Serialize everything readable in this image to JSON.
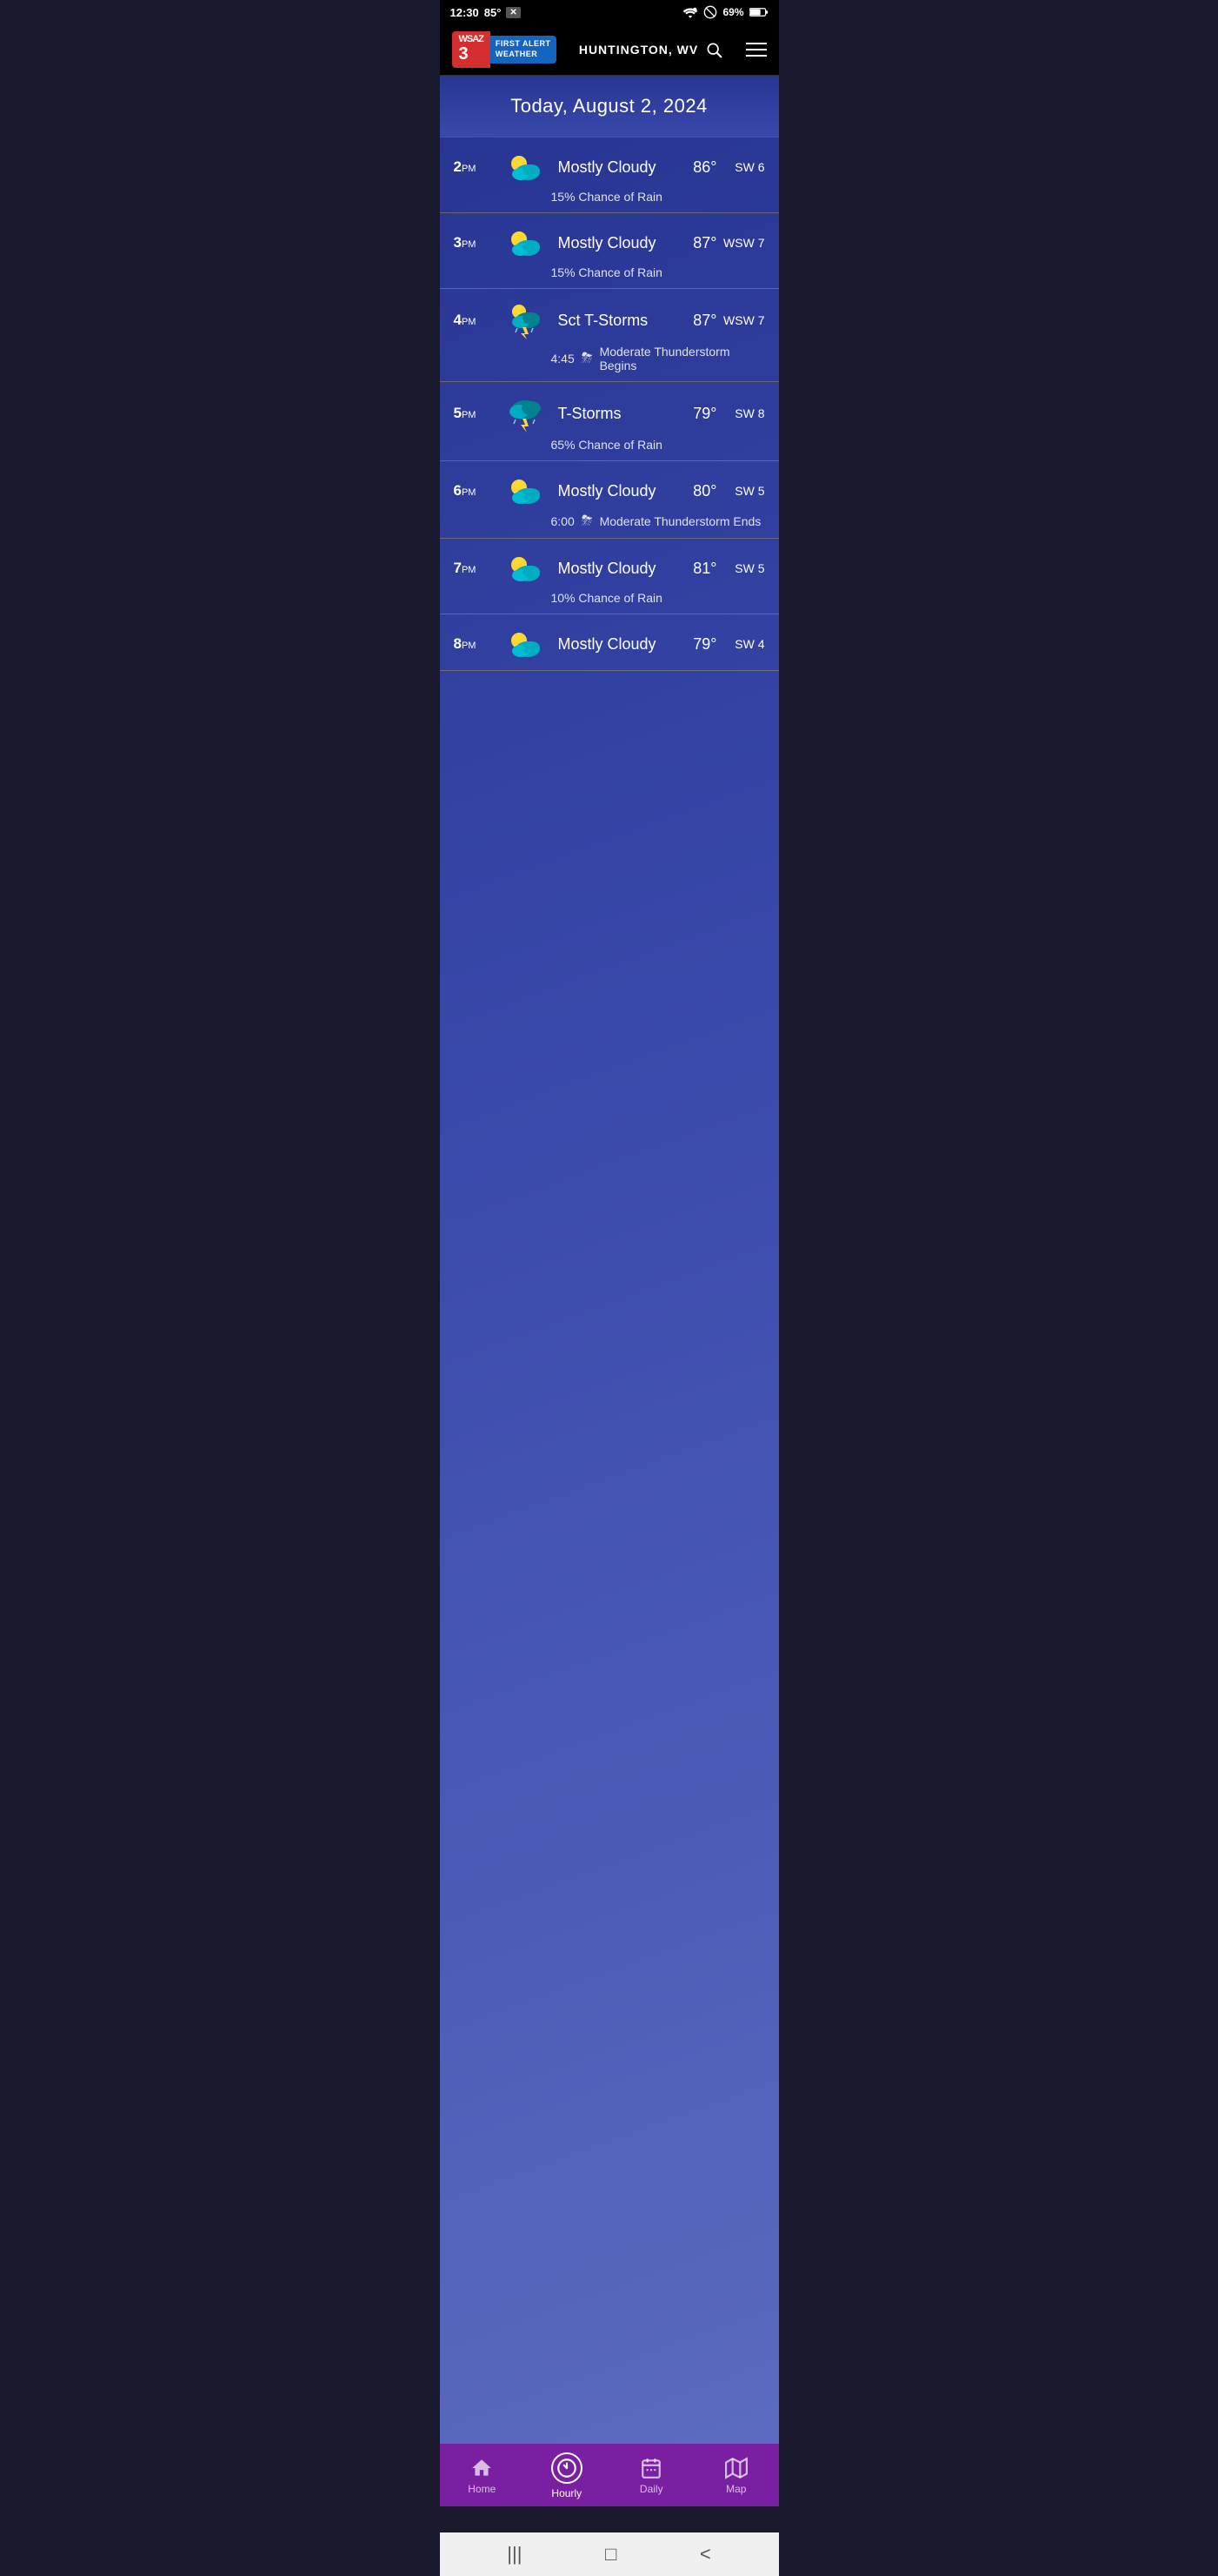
{
  "statusBar": {
    "time": "12:30",
    "temp": "85°",
    "wifi": "wifi",
    "doNotDisturb": "🚫",
    "battery": "69%"
  },
  "header": {
    "logo": {
      "channel": "3",
      "badge": "WSAZ",
      "tag1": "FIRST ALERT",
      "tag2": "WEATHER"
    },
    "location": "HUNTINGTON, WV",
    "searchLabel": "search",
    "menuLabel": "menu"
  },
  "dateBanner": {
    "text": "Today, August 2, 2024"
  },
  "hourlyRows": [
    {
      "hour": "2",
      "ampm": "PM",
      "icon": "partly-cloudy",
      "description": "Mostly Cloudy",
      "temp": "86°",
      "wind": "SW 6",
      "sub": "15% Chance of Rain",
      "subType": "rain",
      "subIcon": "",
      "subTime": ""
    },
    {
      "hour": "3",
      "ampm": "PM",
      "icon": "partly-cloudy",
      "description": "Mostly Cloudy",
      "temp": "87°",
      "wind": "WSW 7",
      "sub": "15% Chance of Rain",
      "subType": "rain",
      "subIcon": "",
      "subTime": ""
    },
    {
      "hour": "4",
      "ampm": "PM",
      "icon": "sct-tstorm",
      "description": "Sct T-Storms",
      "temp": "87°",
      "wind": "WSW 7",
      "sub": "Moderate Thunderstorm Begins",
      "subType": "event",
      "subIcon": "⛈",
      "subTime": "4:45"
    },
    {
      "hour": "5",
      "ampm": "PM",
      "icon": "tstorm",
      "description": "T-Storms",
      "temp": "79°",
      "wind": "SW 8",
      "sub": "65% Chance of Rain",
      "subType": "rain",
      "subIcon": "",
      "subTime": ""
    },
    {
      "hour": "6",
      "ampm": "PM",
      "icon": "partly-cloudy",
      "description": "Mostly Cloudy",
      "temp": "80°",
      "wind": "SW 5",
      "sub": "Moderate Thunderstorm Ends",
      "subType": "event",
      "subIcon": "⛈",
      "subTime": "6:00"
    },
    {
      "hour": "7",
      "ampm": "PM",
      "icon": "partly-cloudy",
      "description": "Mostly Cloudy",
      "temp": "81°",
      "wind": "SW 5",
      "sub": "10% Chance of Rain",
      "subType": "rain",
      "subIcon": "",
      "subTime": ""
    },
    {
      "hour": "8",
      "ampm": "PM",
      "icon": "partly-cloudy",
      "description": "Mostly Cloudy",
      "temp": "79°",
      "wind": "SW 4",
      "sub": "",
      "subType": "",
      "subIcon": "",
      "subTime": ""
    }
  ],
  "bottomNav": {
    "items": [
      {
        "id": "home",
        "label": "Home",
        "active": false
      },
      {
        "id": "hourly",
        "label": "Hourly",
        "active": true
      },
      {
        "id": "daily",
        "label": "Daily",
        "active": false
      },
      {
        "id": "map",
        "label": "Map",
        "active": false
      }
    ]
  },
  "androidNav": {
    "recent": "|||",
    "home": "□",
    "back": "<"
  }
}
